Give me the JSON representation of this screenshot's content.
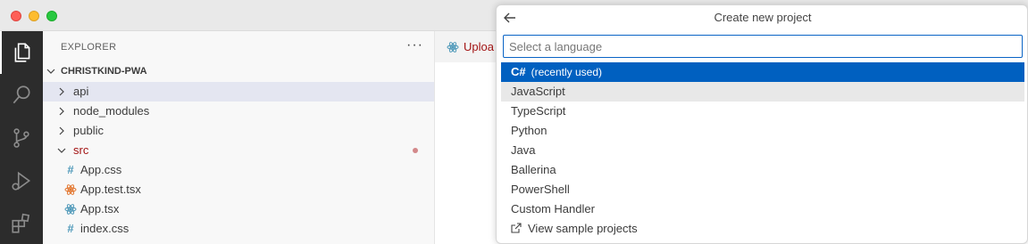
{
  "sidebar": {
    "title": "EXPLORER",
    "more_actions": "···",
    "project_name": "CHRISTKIND-PWA",
    "items": [
      {
        "label": "api",
        "type": "folder"
      },
      {
        "label": "node_modules",
        "type": "folder"
      },
      {
        "label": "public",
        "type": "folder"
      },
      {
        "label": "src",
        "type": "folder-open"
      },
      {
        "label": "App.css",
        "type": "css"
      },
      {
        "label": "App.test.tsx",
        "type": "react-test"
      },
      {
        "label": "App.tsx",
        "type": "react"
      },
      {
        "label": "index.css",
        "type": "css"
      }
    ]
  },
  "editor": {
    "tab_label": "Uploa"
  },
  "quick_pick": {
    "title": "Create new project",
    "placeholder": "Select a language",
    "recent_item": {
      "label": "C#",
      "note": "(recently used)"
    },
    "items": [
      "JavaScript",
      "TypeScript",
      "Python",
      "Java",
      "Ballerina",
      "PowerShell",
      "Custom Handler"
    ],
    "sample_link": "View sample projects"
  },
  "colors": {
    "activity_bar": "#2c2c2c",
    "accent_blue": "#0060c0",
    "modified_folder": "#a31515",
    "react_icon": "#519aba",
    "test_icon": "#e37933"
  },
  "icons": {
    "activity_bar": [
      "files-icon",
      "search-icon",
      "source-control-icon",
      "run-debug-icon",
      "extensions-icon"
    ]
  }
}
